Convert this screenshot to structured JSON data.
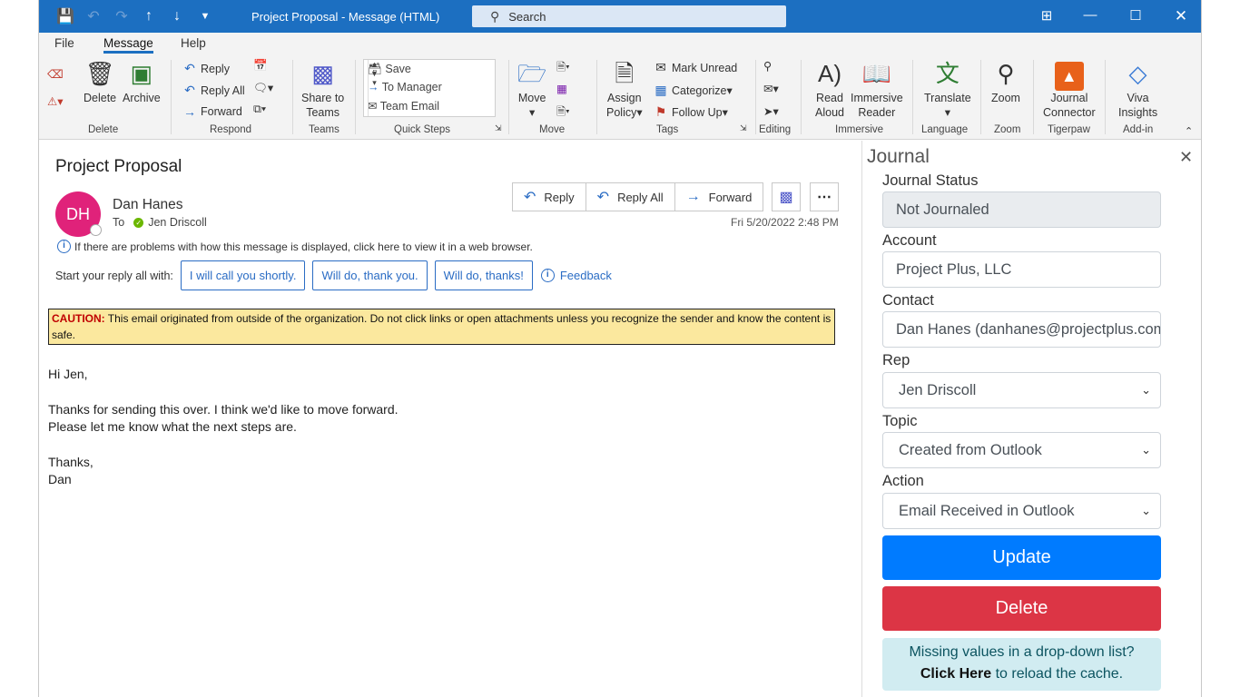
{
  "window": {
    "title": "Project Proposal  -  Message (HTML)",
    "search_placeholder": "Search"
  },
  "menu": {
    "tabs": [
      "File",
      "Message",
      "Help"
    ],
    "active": "Message"
  },
  "ribbon": {
    "delete": {
      "delete_label": "Delete",
      "archive_label": "Archive",
      "group": "Delete"
    },
    "respond": {
      "reply": "Reply",
      "reply_all": "Reply All",
      "forward": "Forward",
      "group": "Respond"
    },
    "teams": {
      "share_label_1": "Share to",
      "share_label_2": "Teams",
      "group": "Teams"
    },
    "quick_steps": {
      "items": [
        "Save",
        "To Manager",
        "Team Email"
      ],
      "group": "Quick Steps"
    },
    "move": {
      "label": "Move",
      "group": "Move"
    },
    "tags": {
      "assign_1": "Assign",
      "assign_2": "Policy",
      "mark_unread": "Mark Unread",
      "categorize": "Categorize",
      "follow_up": "Follow Up",
      "group": "Tags"
    },
    "editing": {
      "group": "Editing"
    },
    "immersive": {
      "read_1": "Read",
      "read_2": "Aloud",
      "reader_1": "Immersive",
      "reader_2": "Reader",
      "group": "Immersive"
    },
    "language": {
      "translate": "Translate",
      "group": "Language"
    },
    "zoom": {
      "label": "Zoom",
      "group": "Zoom"
    },
    "tigerpaw": {
      "label_1": "Journal",
      "label_2": "Connector",
      "group": "Tigerpaw"
    },
    "addin": {
      "label_1": "Viva",
      "label_2": "Insights",
      "group": "Add-in"
    }
  },
  "message": {
    "subject": "Project Proposal",
    "avatar_initials": "DH",
    "sender": "Dan Hanes",
    "to_label": "To",
    "recipient": "Jen Driscoll",
    "datetime": "Fri 5/20/2022 2:48 PM",
    "actions": {
      "reply": "Reply",
      "reply_all": "Reply All",
      "forward": "Forward"
    },
    "info_text": "If there are problems with how this message is displayed, click here to view it in a web browser.",
    "reply_prompt": "Start your reply all with:",
    "suggestions": [
      "I will call you shortly.",
      "Will do, thank you.",
      "Will do, thanks!"
    ],
    "feedback": "Feedback",
    "caution_label": "CAUTION:",
    "caution_text": " This email originated from outside of the organization. Do not click links or open attachments unless you recognize the sender and know the content is safe.",
    "body": [
      "Hi Jen,",
      "",
      "Thanks for sending this over. I think we'd like to move forward.",
      "Please let me know what the next steps are.",
      "",
      "Thanks,",
      "Dan"
    ]
  },
  "journal": {
    "title": "Journal",
    "status_label": "Journal Status",
    "status_value": "Not Journaled",
    "account_label": "Account",
    "account_value": "Project Plus, LLC",
    "contact_label": "Contact",
    "contact_value": "Dan Hanes (danhanes@projectplus.com)",
    "rep_label": "Rep",
    "rep_value": "Jen Driscoll",
    "topic_label": "Topic",
    "topic_value": "Created from Outlook",
    "action_label": "Action",
    "action_value": "Email Received in Outlook",
    "update_button": "Update",
    "delete_button": "Delete",
    "cache_line1": "Missing values in a drop-down list?",
    "cache_click": "Click Here",
    "cache_rest": " to reload the cache.",
    "colors": {
      "update": "#007bff",
      "delete": "#dc3545",
      "info_bg": "#d1ecf1"
    }
  }
}
